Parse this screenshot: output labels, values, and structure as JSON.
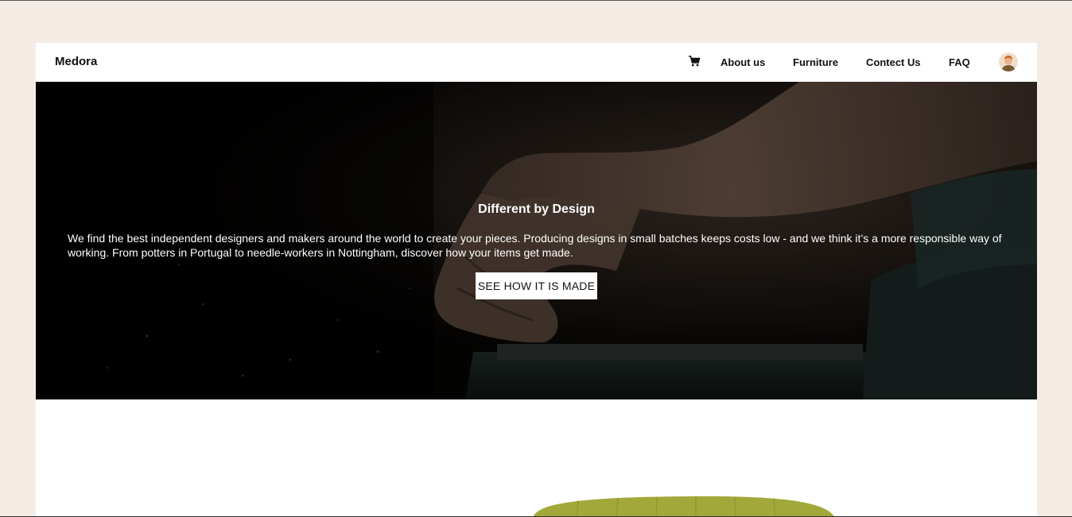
{
  "navbar": {
    "brand": "Medora",
    "cart_icon": "shopping-cart-icon",
    "links": [
      "About us",
      "Furniture",
      "Contect Us",
      "FAQ"
    ],
    "avatar_icon": "user-avatar-icon"
  },
  "hero": {
    "title": "Different by Design",
    "text": "We find the best independent designers and makers around the world to create your pieces. Producing designs in small batches keeps costs low - and we think it’s a more responsible way of working. From potters in Portugal to needle-workers in Nottingham, discover how your items get made.",
    "button_label": "SEE HOW IT IS MADE"
  },
  "colors": {
    "page_background": "#f5ebe5",
    "card_background": "#ffffff",
    "hero_overlay": "#050403",
    "product_green": "#a3a83a"
  }
}
